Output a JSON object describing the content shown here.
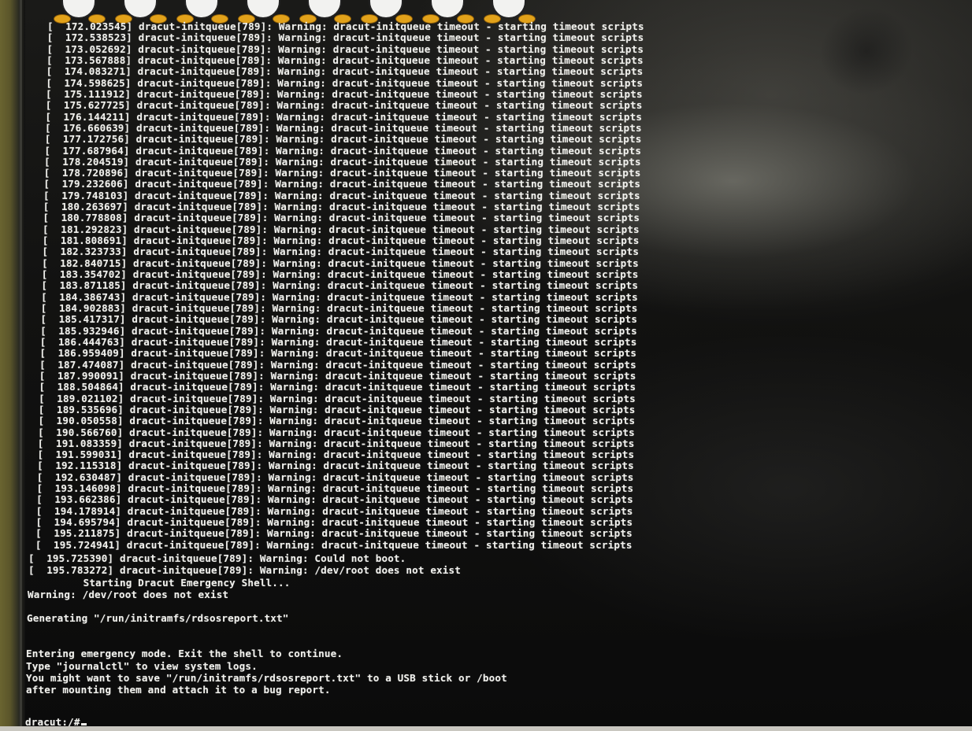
{
  "console": {
    "timeout_lines": [
      "[  172.023545] dracut-initqueue[789]: Warning: dracut-initqueue timeout - starting timeout scripts",
      "[  172.538523] dracut-initqueue[789]: Warning: dracut-initqueue timeout - starting timeout scripts",
      "[  173.052692] dracut-initqueue[789]: Warning: dracut-initqueue timeout - starting timeout scripts",
      "[  173.567888] dracut-initqueue[789]: Warning: dracut-initqueue timeout - starting timeout scripts",
      "[  174.083271] dracut-initqueue[789]: Warning: dracut-initqueue timeout - starting timeout scripts",
      "[  174.598625] dracut-initqueue[789]: Warning: dracut-initqueue timeout - starting timeout scripts",
      "[  175.111912] dracut-initqueue[789]: Warning: dracut-initqueue timeout - starting timeout scripts",
      "[  175.627725] dracut-initqueue[789]: Warning: dracut-initqueue timeout - starting timeout scripts",
      "[  176.144211] dracut-initqueue[789]: Warning: dracut-initqueue timeout - starting timeout scripts",
      "[  176.660639] dracut-initqueue[789]: Warning: dracut-initqueue timeout - starting timeout scripts",
      "[  177.172756] dracut-initqueue[789]: Warning: dracut-initqueue timeout - starting timeout scripts",
      "[  177.687964] dracut-initqueue[789]: Warning: dracut-initqueue timeout - starting timeout scripts",
      "[  178.204519] dracut-initqueue[789]: Warning: dracut-initqueue timeout - starting timeout scripts",
      "[  178.720896] dracut-initqueue[789]: Warning: dracut-initqueue timeout - starting timeout scripts",
      "[  179.232606] dracut-initqueue[789]: Warning: dracut-initqueue timeout - starting timeout scripts",
      "[  179.748103] dracut-initqueue[789]: Warning: dracut-initqueue timeout - starting timeout scripts",
      "[  180.263697] dracut-initqueue[789]: Warning: dracut-initqueue timeout - starting timeout scripts",
      "[  180.778808] dracut-initqueue[789]: Warning: dracut-initqueue timeout - starting timeout scripts",
      "[  181.292823] dracut-initqueue[789]: Warning: dracut-initqueue timeout - starting timeout scripts",
      "[  181.808691] dracut-initqueue[789]: Warning: dracut-initqueue timeout - starting timeout scripts",
      "[  182.323733] dracut-initqueue[789]: Warning: dracut-initqueue timeout - starting timeout scripts",
      "[  182.840715] dracut-initqueue[789]: Warning: dracut-initqueue timeout - starting timeout scripts",
      "[  183.354702] dracut-initqueue[789]: Warning: dracut-initqueue timeout - starting timeout scripts",
      "[  183.871185] dracut-initqueue[789]: Warning: dracut-initqueue timeout - starting timeout scripts",
      "[  184.386743] dracut-initqueue[789]: Warning: dracut-initqueue timeout - starting timeout scripts",
      "[  184.902883] dracut-initqueue[789]: Warning: dracut-initqueue timeout - starting timeout scripts",
      "[  185.417317] dracut-initqueue[789]: Warning: dracut-initqueue timeout - starting timeout scripts",
      "[  185.932946] dracut-initqueue[789]: Warning: dracut-initqueue timeout - starting timeout scripts",
      "[  186.444763] dracut-initqueue[789]: Warning: dracut-initqueue timeout - starting timeout scripts",
      "[  186.959409] dracut-initqueue[789]: Warning: dracut-initqueue timeout - starting timeout scripts",
      "[  187.474087] dracut-initqueue[789]: Warning: dracut-initqueue timeout - starting timeout scripts",
      "[  187.990091] dracut-initqueue[789]: Warning: dracut-initqueue timeout - starting timeout scripts",
      "[  188.504864] dracut-initqueue[789]: Warning: dracut-initqueue timeout - starting timeout scripts",
      "[  189.021102] dracut-initqueue[789]: Warning: dracut-initqueue timeout - starting timeout scripts",
      "[  189.535696] dracut-initqueue[789]: Warning: dracut-initqueue timeout - starting timeout scripts",
      "[  190.050558] dracut-initqueue[789]: Warning: dracut-initqueue timeout - starting timeout scripts",
      "[  190.566760] dracut-initqueue[789]: Warning: dracut-initqueue timeout - starting timeout scripts",
      "[  191.083359] dracut-initqueue[789]: Warning: dracut-initqueue timeout - starting timeout scripts",
      "[  191.599031] dracut-initqueue[789]: Warning: dracut-initqueue timeout - starting timeout scripts",
      "[  192.115318] dracut-initqueue[789]: Warning: dracut-initqueue timeout - starting timeout scripts",
      "[  192.630487] dracut-initqueue[789]: Warning: dracut-initqueue timeout - starting timeout scripts",
      "[  193.146098] dracut-initqueue[789]: Warning: dracut-initqueue timeout - starting timeout scripts",
      "[  193.662386] dracut-initqueue[789]: Warning: dracut-initqueue timeout - starting timeout scripts",
      "[  194.178914] dracut-initqueue[789]: Warning: dracut-initqueue timeout - starting timeout scripts",
      "[  194.695794] dracut-initqueue[789]: Warning: dracut-initqueue timeout - starting timeout scripts",
      "[  195.211875] dracut-initqueue[789]: Warning: dracut-initqueue timeout - starting timeout scripts",
      "[  195.724941] dracut-initqueue[789]: Warning: dracut-initqueue timeout - starting timeout scripts"
    ],
    "could_not_boot": "[  195.725390] dracut-initqueue[789]: Warning: Could not boot.",
    "root_missing": "[  195.783272] dracut-initqueue[789]: Warning: /dev/root does not exist",
    "starting_shell": "         Starting Dracut Emergency Shell...",
    "warning_root": "Warning: /dev/root does not exist",
    "generating": "Generating \"/run/initramfs/rdsosreport.txt\"",
    "emergency_1": "Entering emergency mode. Exit the shell to continue.",
    "emergency_2": "Type \"journalctl\" to view system logs.",
    "emergency_3": "You might want to save \"/run/initramfs/rdsosreport.txt\" to a USB stick or /boot",
    "emergency_4": "after mounting them and attach it to a bug report.",
    "prompt": "dracut:/#"
  },
  "logo_count": 8
}
